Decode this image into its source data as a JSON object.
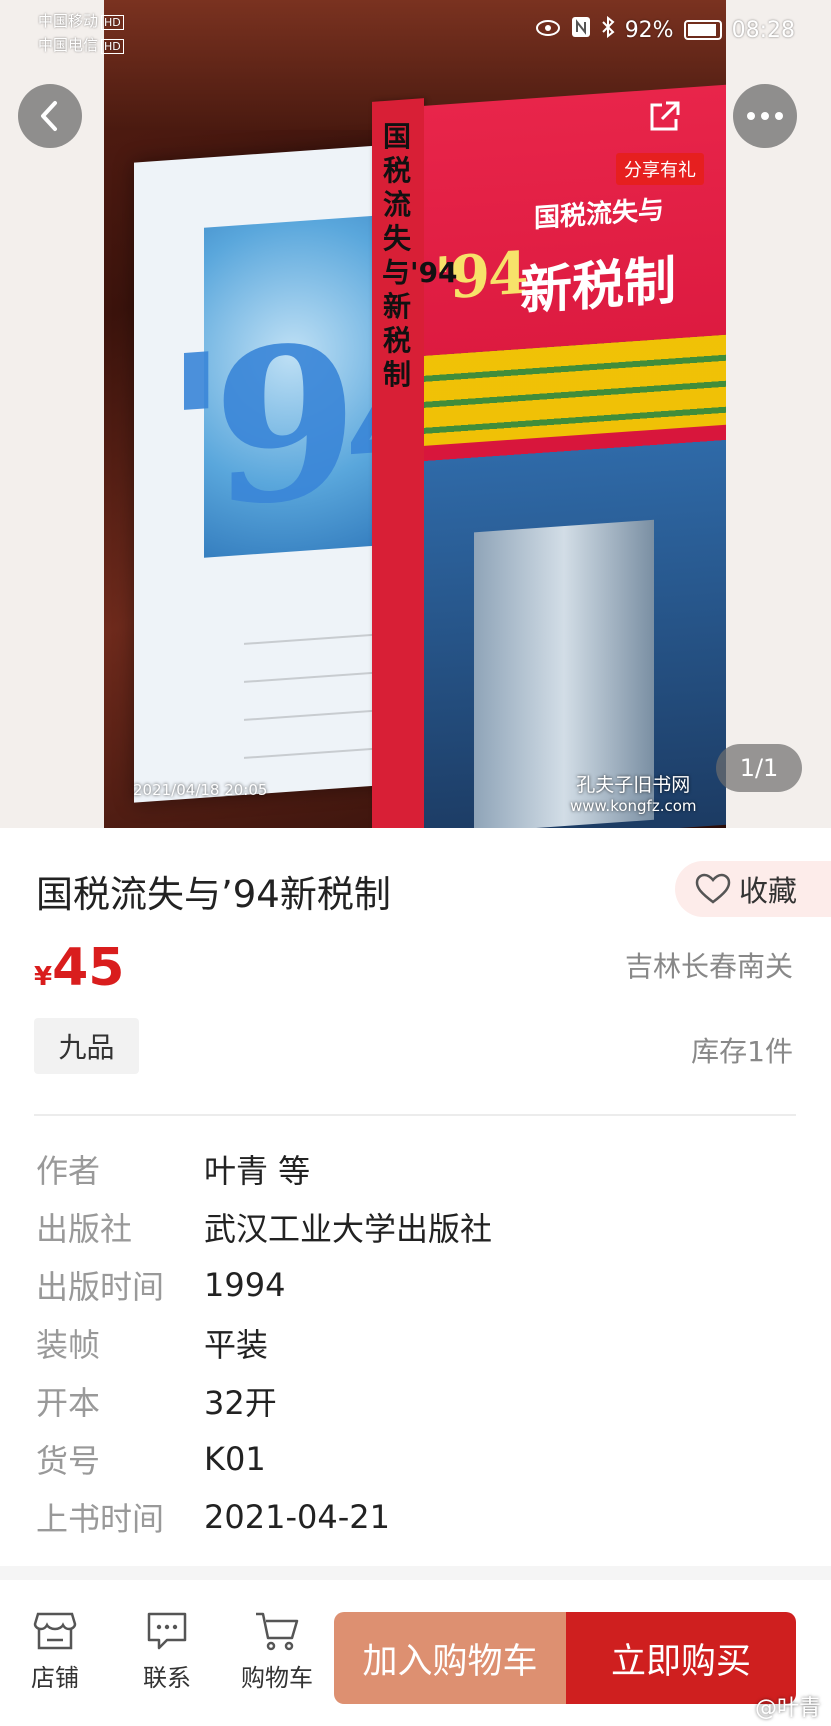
{
  "status_bar": {
    "carrier_1": "中国移动",
    "carrier_2": "中国电信",
    "hd_badge": "HD",
    "battery": "92%",
    "time": "08:28"
  },
  "photo": {
    "timestamp": "2021/04/18 20:05",
    "watermark_title": "孔夫子旧书网",
    "watermark_url": "www.kongfz.com",
    "page_indicator": "1/1",
    "cover_text": {
      "spine": "国税流失与'94新税制",
      "front_subtitle": "国税流失与",
      "front_year": "'94",
      "front_title": "新税制"
    }
  },
  "top_actions": {
    "share_label": "分享有礼"
  },
  "product": {
    "title": "国税流失与’94新税制",
    "favorite_label": "收藏",
    "currency": "¥",
    "price": "45",
    "location": "吉林长春南关",
    "condition": "九品",
    "stock": "库存1件"
  },
  "details": [
    {
      "label": "作者",
      "value": "叶青 等"
    },
    {
      "label": "出版社",
      "value": "武汉工业大学出版社"
    },
    {
      "label": "出版时间",
      "value": "1994"
    },
    {
      "label": "装帧",
      "value": "平装"
    },
    {
      "label": "开本",
      "value": "32开"
    },
    {
      "label": "货号",
      "value": "K01"
    },
    {
      "label": "上书时间",
      "value": "2021-04-21"
    }
  ],
  "bottom_bar": {
    "tabs": [
      {
        "label": "店铺",
        "icon": "store-icon"
      },
      {
        "label": "联系",
        "icon": "chat-icon"
      },
      {
        "label": "购物车",
        "icon": "cart-icon"
      }
    ],
    "add_to_cart": "加入购物车",
    "buy_now": "立即购买"
  },
  "weibo_watermark": "@叶青",
  "colors": {
    "accent_red": "#cf1f1f",
    "price_red": "#d91d1d",
    "cart_orange": "#dd9071"
  }
}
